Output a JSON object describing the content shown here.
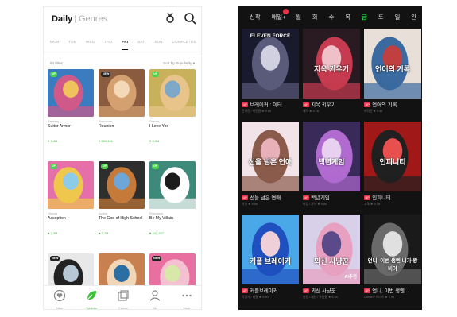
{
  "left_app": {
    "header": {
      "title": "Daily",
      "genres_tab": "Genres"
    },
    "icons": {
      "gender": "gender-icon",
      "search": "search-icon"
    },
    "days": [
      "MON",
      "TUE",
      "WED",
      "THU",
      "FRI",
      "SAT",
      "SUN",
      "COMPLETED"
    ],
    "active_day": "FRI",
    "count_label": "84 titles",
    "sort_label": "Sort by Popularity ▾",
    "cards": [
      {
        "genre": "Fantasy",
        "name": "Suitor Armor",
        "likes": "♥ 6.4M",
        "badge": "UP",
        "colors": [
          "#3b7bbf",
          "#cf5a8a",
          "#f0c25b"
        ]
      },
      {
        "genre": "Romance",
        "name": "Reunion",
        "likes": "♥ 599,441",
        "badge": "NEW",
        "colors": [
          "#8a5b3e",
          "#d4a070",
          "#f3d9b8"
        ]
      },
      {
        "genre": "Drama",
        "name": "I Love Yoo",
        "likes": "♥ 3.3M",
        "badge": "UP",
        "colors": [
          "#c9b15b",
          "#e8c48a",
          "#7da8c8"
        ]
      },
      {
        "genre": "Drama",
        "name": "Acception",
        "likes": "♥ 2.3M",
        "badge": "UP",
        "colors": [
          "#e56fa8",
          "#f0c74d",
          "#8ecbe8"
        ]
      },
      {
        "genre": "Action",
        "name": "The God of High School",
        "likes": "♥ 7.7M",
        "badge": "UP",
        "colors": [
          "#2e2e2e",
          "#c57a3a",
          "#6ea6d8"
        ]
      },
      {
        "genre": "Romance",
        "name": "Be My Villain",
        "likes": "♥ 442,257",
        "badge": "UP",
        "colors": [
          "#3e8a7a",
          "#ffffff",
          "#1c1c1c"
        ]
      },
      {
        "genre": "",
        "name": "",
        "likes": "",
        "badge": "NEW",
        "colors": [
          "#e8e8e8",
          "#222222",
          "#b8c7d6"
        ]
      },
      {
        "genre": "",
        "name": "",
        "likes": "",
        "badge": "",
        "colors": [
          "#c88050",
          "#f1d7b8",
          "#2a6ea3"
        ]
      },
      {
        "genre": "",
        "name": "",
        "likes": "",
        "badge": "NEW",
        "colors": [
          "#e86f9f",
          "#f5c0d1",
          "#d8e8a8"
        ]
      }
    ],
    "tabbar": [
      {
        "label": "Mine",
        "icon": "heart-circle-icon",
        "active": false
      },
      {
        "label": "Originals",
        "icon": "leaf-icon",
        "active": true
      },
      {
        "label": "Canvas",
        "icon": "canvas-icon",
        "active": false
      },
      {
        "label": "My",
        "icon": "person-icon",
        "active": false
      },
      {
        "label": "More",
        "icon": "more-icon",
        "active": false
      }
    ]
  },
  "right_app": {
    "days": [
      "신작",
      "매일+",
      "월",
      "화",
      "수",
      "목",
      "금",
      "토",
      "일",
      "완"
    ],
    "active_day": "금",
    "cards": [
      {
        "art_title": "ELEVEN FORCE",
        "name": "브레이커 : 이터...",
        "meta": "전극진 / 박진환 ★ 9.95",
        "up": true,
        "colors": [
          "#1a1a2e",
          "#5a5a7a",
          "#d0d0e0"
        ]
      },
      {
        "art_title": "지옥 키우기",
        "name": "지옥 키우기",
        "meta": "제작 ★ 9.78",
        "up": true,
        "colors": [
          "#2a1a22",
          "#c63b4f",
          "#f0c0c8"
        ]
      },
      {
        "art_title": "언어의 기록",
        "name": "언어의 기록",
        "meta": "제작진 ★ 9.46",
        "up": true,
        "colors": [
          "#e8e0d8",
          "#3a6aa0",
          "#c04040"
        ]
      },
      {
        "art_title": "선을 넘은 연애",
        "name": "선을 넘은 연애",
        "meta": "이연 ★ 9.96",
        "up": true,
        "colors": [
          "#f2e3e8",
          "#8a5a4a",
          "#e8b0b8"
        ]
      },
      {
        "art_title": "백년게임",
        "name": "백년게임",
        "meta": "바임 / 가아 ★ 9.84",
        "up": true,
        "colors": [
          "#3a2a5a",
          "#b06ad0",
          "#e8d0f0"
        ]
      },
      {
        "art_title": "인피니티",
        "name": "인피니티",
        "meta": "고도 ★ 9.78",
        "up": true,
        "colors": [
          "#a01818",
          "#202020",
          "#e85050"
        ]
      },
      {
        "art_title": "커플 브레이커",
        "name": "커플브레이커",
        "meta": "이영기 / 제갈 ★ 9.90",
        "up": true,
        "colors": [
          "#4aa8e8",
          "#2050c0",
          "#f0d0d8"
        ]
      },
      {
        "art_title": "뫼신 사냥꾼",
        "name": "뫼신 사냥꾼",
        "meta": "송원 / 재찬 / 유원왕 ★ 9.95",
        "up": true,
        "ai_label": "AI추천",
        "colors": [
          "#d8d0e8",
          "#e8a0c0",
          "#5a4a8a"
        ]
      },
      {
        "art_title": "언니, 이번 생엔 내가 왕비야",
        "name": "언니, 이번 생엔...",
        "meta": "Cimsin / 미티스 ★ 9.95",
        "up": true,
        "colors": [
          "#1a1a1a",
          "#6a6a6a",
          "#e0e0e0"
        ]
      }
    ]
  }
}
